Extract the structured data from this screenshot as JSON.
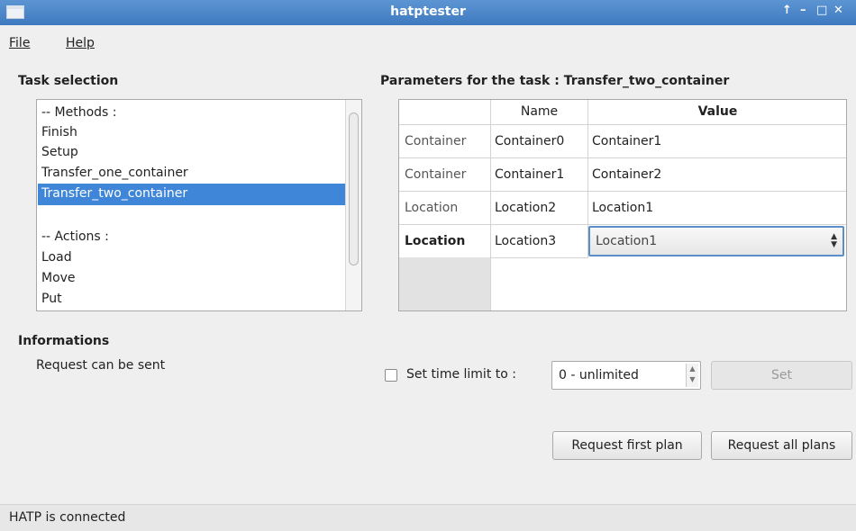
{
  "window": {
    "title": "hatptester",
    "controls": [
      "↑",
      "–",
      "□",
      "✕"
    ]
  },
  "menu": {
    "file": "File",
    "help": "Help"
  },
  "task_selection": {
    "label": "Task selection",
    "items": [
      "-- Methods :",
      "Finish",
      "Setup",
      "Transfer_one_container",
      "Transfer_two_container",
      "",
      "-- Actions :",
      "Load",
      "Move",
      "Put"
    ],
    "selected": "Transfer_two_container"
  },
  "informations": {
    "label": "Informations",
    "text": "Request can be sent"
  },
  "parameters": {
    "label": "Parameters for the task : Transfer_two_container",
    "headers": {
      "name": "Name",
      "value": "Value"
    },
    "rows": [
      {
        "type": "Container",
        "name": "Container0",
        "value": "Container1"
      },
      {
        "type": "Container",
        "name": "Container1",
        "value": "Container2"
      },
      {
        "type": "Location",
        "name": "Location2",
        "value": "Location1"
      },
      {
        "type": "Location",
        "name": "Location3",
        "value": "Location1"
      }
    ]
  },
  "time_limit": {
    "checkbox_label": "Set time limit to :",
    "value": "0 - unlimited",
    "set_button": "Set"
  },
  "buttons": {
    "request_first": "Request first plan",
    "request_all": "Request all plans"
  },
  "status": {
    "text": "HATP is connected"
  }
}
